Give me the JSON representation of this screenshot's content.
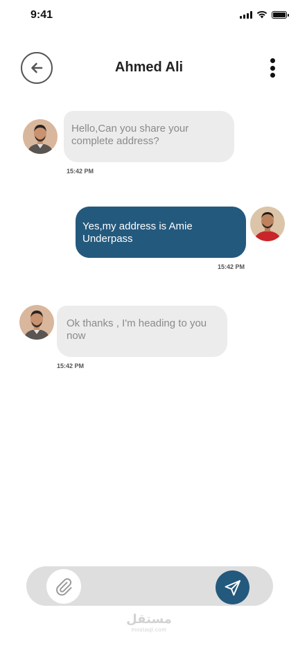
{
  "status_bar": {
    "time": "9:41"
  },
  "header": {
    "title": "Ahmed Ali"
  },
  "messages": [
    {
      "direction": "incoming",
      "text": "Hello,Can you share your complete address?",
      "time": "15:42 PM"
    },
    {
      "direction": "outgoing",
      "text": "Yes,my address is Amie Underpass",
      "time": "15:42 PM"
    },
    {
      "direction": "incoming",
      "text": "Ok thanks , I'm heading to you now",
      "time": "15:42 PM"
    }
  ],
  "composer": {
    "placeholder": "",
    "value": ""
  },
  "watermark": {
    "arabic": "مستقل",
    "latin": "mostaql.com"
  },
  "colors": {
    "accent": "#23597d",
    "incoming_bubble": "#ececec",
    "composer_bg": "#dedede"
  },
  "icons": {
    "back": "arrow-left-icon",
    "more": "vertical-dots-icon",
    "attach": "paperclip-icon",
    "send": "paper-plane-icon"
  }
}
